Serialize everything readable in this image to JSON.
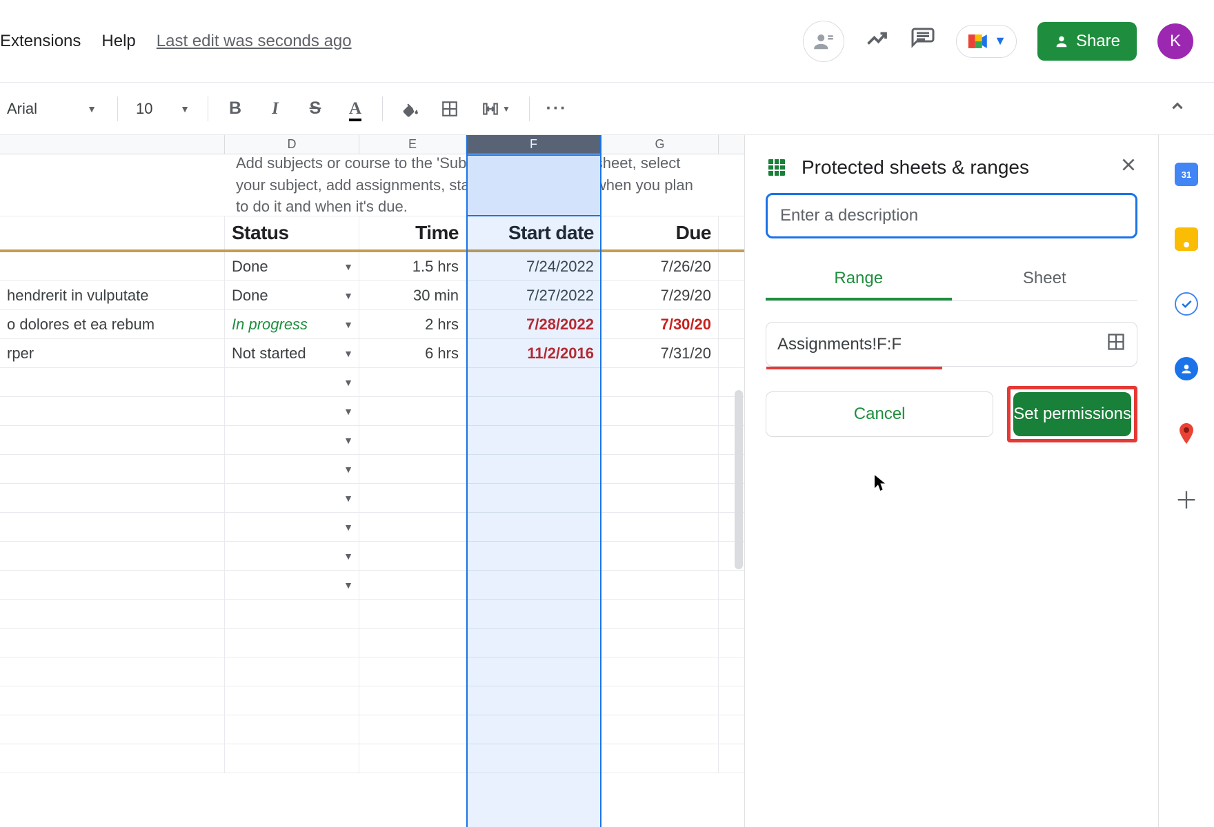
{
  "header": {
    "menus": {
      "extensions": "Extensions",
      "help": "Help"
    },
    "last_edit": "Last edit was seconds ago",
    "share_label": "Share",
    "avatar_letter": "K"
  },
  "toolbar": {
    "font_name": "Arial",
    "font_size": "10",
    "buttons": {
      "bold": "B",
      "italic": "I",
      "strike": "S",
      "text_color": "A",
      "more": "···"
    }
  },
  "sheet": {
    "columns": {
      "D": "D",
      "E": "E",
      "F": "F",
      "G": "G"
    },
    "instruction_text": "Add subjects or course to the 'Subjects' sheet. In this sheet, select your subject, add assignments, status, time required, when you plan to do it and when it's due.",
    "headers": {
      "status": "Status",
      "time": "Time",
      "start": "Start date",
      "due": "Due"
    },
    "rows": [
      {
        "c": "",
        "status": "Done",
        "time": "1.5 hrs",
        "start": "7/24/2022",
        "start_red": false,
        "due": "7/26/20",
        "due_red": false
      },
      {
        "c": "hendrerit in vulputate",
        "status": "Done",
        "time": "30 min",
        "start": "7/27/2022",
        "start_red": false,
        "due": "7/29/20",
        "due_red": false
      },
      {
        "c": "o dolores et ea rebum",
        "status": "In progress",
        "status_cls": "inprogress",
        "time": "2 hrs",
        "start": "7/28/2022",
        "start_red": true,
        "due": "7/30/20",
        "due_red": true
      },
      {
        "c": "rper",
        "status": "Not started",
        "time": "6 hrs",
        "start": "11/2/2016",
        "start_red": true,
        "due": "7/31/20",
        "due_red": false
      }
    ]
  },
  "panel": {
    "title": "Protected sheets & ranges",
    "description_placeholder": "Enter a description",
    "tabs": {
      "range": "Range",
      "sheet": "Sheet"
    },
    "range_value": "Assignments!F:F",
    "cancel_label": "Cancel",
    "set_label": "Set permissions"
  },
  "rail": {
    "calendar": "calendar-icon",
    "keep": "keep-icon",
    "tasks": "tasks-icon",
    "contacts": "contacts-icon",
    "maps": "maps-icon",
    "add": "add-icon"
  }
}
